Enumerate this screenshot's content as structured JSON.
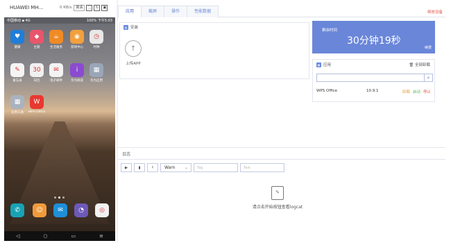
{
  "device": {
    "name": "HUAWEI MH...",
    "speed": "0 KB/s",
    "quality": "高清",
    "status_left": "中国移动 ▪ 4G",
    "status_right": "100% 下午5:03"
  },
  "phone_apps": [
    {
      "label": "健康",
      "color": "#1e7ed9",
      "icon": "♥"
    },
    {
      "label": "主题",
      "color": "#e8566b",
      "icon": "◆"
    },
    {
      "label": "生活服务",
      "color": "#f08a24",
      "icon": "☕"
    },
    {
      "label": "游戏中心",
      "color": "#f2a03c",
      "icon": "◉"
    },
    {
      "label": "时钟",
      "color": "#e8e8e8",
      "icon": "◷"
    },
    {
      "label": "备忘录",
      "color": "#f5f5f5",
      "icon": "✎"
    },
    {
      "label": "日历",
      "color": "#f0f0f0",
      "icon": "30"
    },
    {
      "label": "电子邮件",
      "color": "#f3f3f3",
      "icon": "✉"
    },
    {
      "label": "华为阅读",
      "color": "#8b4bd0",
      "icon": "i"
    },
    {
      "label": "华为应用",
      "color": "#9aa6b8",
      "icon": "▦"
    },
    {
      "label": "实用工具",
      "color": "#a9b3bf",
      "icon": "▦"
    },
    {
      "label": "WPS Office",
      "color": "#e8382f",
      "icon": "W"
    },
    {
      "label": "",
      "color": "#17a3b5",
      "icon": "✆"
    },
    {
      "label": "",
      "color": "#f09a3a",
      "icon": "☺"
    },
    {
      "label": "",
      "color": "#1e8fd8",
      "icon": "✉"
    },
    {
      "label": "",
      "color": "#6d5ab8",
      "icon": "◔"
    },
    {
      "label": "",
      "color": "#f2f2f2",
      "icon": "◎"
    }
  ],
  "nav": {
    "back": "◁",
    "home": "○",
    "recent": "▭",
    "menu": "≡"
  },
  "tabs": [
    {
      "label": "应用"
    },
    {
      "label": "截屏"
    },
    {
      "label": "操作"
    },
    {
      "label": "性能数据"
    }
  ],
  "restart_label": "释放设备",
  "install": {
    "title": "安装",
    "upload_label": "上传APP"
  },
  "time": {
    "label": "剩余时间",
    "value": "30分钟19秒",
    "renew": "续费"
  },
  "apps_panel": {
    "title": "应用",
    "uninstall_all": "全部卸载",
    "search_placeholder": ""
  },
  "app_list": [
    {
      "name": "WPS Office",
      "version": "10.9.1",
      "uninstall": "卸载",
      "start": "启动",
      "stop": "停止"
    }
  ],
  "log": {
    "title": "日志",
    "level": "Warn",
    "tag_placeholder": "Tag",
    "text_placeholder": "Text",
    "empty_text": "请点击开始按钮查看logcat"
  },
  "colors": {
    "accent": "#6a86d9",
    "danger": "#e05a4d",
    "start": "#5bb85d",
    "uninstall": "#e8a33b"
  }
}
